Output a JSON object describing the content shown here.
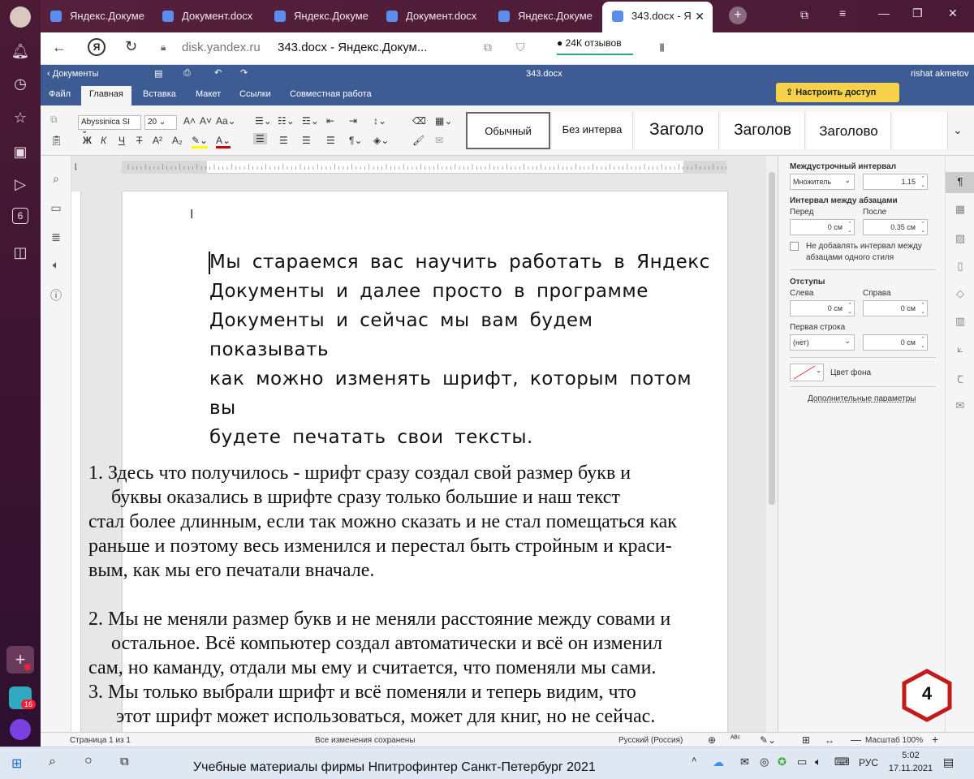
{
  "browser": {
    "tabs": [
      {
        "title": "Яндекс.Докуме"
      },
      {
        "title": "Документ.docx"
      },
      {
        "title": "Яндекс.Докуме"
      },
      {
        "title": "Документ.docx"
      },
      {
        "title": "Яндекс.Докуме"
      },
      {
        "title": "343.docx - Я"
      }
    ],
    "address_domain": "disk.yandex.ru",
    "page_title": "343.docx - Яндекс.Докум...",
    "reviews_badge": "24К отзывов",
    "sidebar_badge_count": "6",
    "sidebar_bottom_badge": "16"
  },
  "docs": {
    "back_label": "Документы",
    "filename": "343.docx",
    "user": "rishat akmetov",
    "menu": [
      "Файл",
      "Главная",
      "Вставка",
      "Макет",
      "Ссылки",
      "Совместная работа"
    ],
    "share_button": "Настроить доступ",
    "font_name": "Abyssinica SI",
    "font_size": "20",
    "styles": [
      "Обычный",
      "Без интерва",
      "Заголо",
      "Заголов",
      "Заголово"
    ]
  },
  "right_panel": {
    "line_spacing_title": "Междустрочный интервал",
    "line_spacing_mode": "Множитель",
    "line_spacing_value": "1.15",
    "para_spacing_title": "Интервал между абзацами",
    "before_label": "Перед",
    "before_value": "0 см",
    "after_label": "После",
    "after_value": "0.35 см",
    "no_space_label_1": "Не добавлять интервал между",
    "no_space_label_2": "абзацами одного стиля",
    "indents_title": "Отступы",
    "left_label": "Слева",
    "left_value": "0 см",
    "right_label": "Справа",
    "right_value": "0 см",
    "first_line_label": "Первая строка",
    "first_line_mode": "(нет)",
    "first_line_value": "0 см",
    "bg_color_label": "Цвет фона",
    "more_params": "Дополнительные параметры"
  },
  "document": {
    "sans_lines": [
      "Мы стараемся вас научить работать в Яндекс",
      "Документы и далее просто в программе",
      "Документы и сейчас мы вам будем",
      "показывать",
      "как можно изменять шрифт, которым потом",
      "вы",
      "будете печатать свои тексты."
    ],
    "serif_lines": [
      "1. Здесь что получилось - шрифт сразу создал свой размер букв и",
      "буквы оказались в шрифте сразу только большие и наш текст",
      "стал более длинным, если так можно сказать и не стал помещаться как",
      "раньше и поэтому весь изменился и перестал быть стройным и краси-",
      "вым, как мы его печатали вначале.",
      "2. Мы не меняли размер букв и не меняли расстояние между совами и",
      "остальное. Всё компьютер создал автоматически и всё он изменил",
      "сам, но каманду, отдали мы ему и считается, что поменяли мы сами.",
      "3. Мы только выбрали шрифт и всё поменяли и теперь видим, что",
      "этот шрифт может использоваться, может для книг, но не сейчас."
    ],
    "badge_number": "4"
  },
  "status": {
    "page": "Страница 1 из 1",
    "saved": "Все изменения сохранены",
    "language": "Русский (Россия)",
    "zoom": "Масштаб 100%"
  },
  "taskbar": {
    "caption": "Учебные материалы фирмы Нпитрофинтер Санкт-Петербург 2021",
    "lang": "РУС",
    "time": "5:02",
    "date": "17.11.2021"
  }
}
